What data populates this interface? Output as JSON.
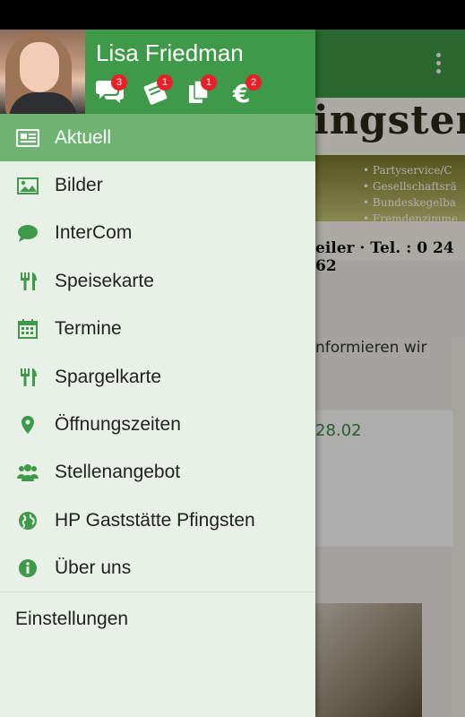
{
  "colors": {
    "primary": "#3e9a48",
    "active_item": "#6fb472",
    "drawer_bg": "#e9f0e7",
    "badge": "#e8202a"
  },
  "background": {
    "logo": "ingsten",
    "services": [
      "Partyservice/C",
      "Gesellschaftsrä",
      "Bundeskegelba",
      "Fremdenzimme"
    ],
    "tel": "eiler · Tel. : 0 24 62",
    "text": "nformieren wir",
    "date": "28.02"
  },
  "header": {
    "user_name": "Lisa Friedman",
    "icons": [
      {
        "icon": "chat-icon",
        "badge": "3"
      },
      {
        "icon": "ticket-icon",
        "badge": "1"
      },
      {
        "icon": "pages-icon",
        "badge": "1"
      },
      {
        "icon": "euro-icon",
        "badge": "2"
      }
    ]
  },
  "menu": {
    "items": [
      {
        "label": "Aktuell",
        "icon": "newspaper-icon"
      },
      {
        "label": "Bilder",
        "icon": "image-icon"
      },
      {
        "label": "InterCom",
        "icon": "speech-bubble-icon"
      },
      {
        "label": "Speisekarte",
        "icon": "cutlery-icon"
      },
      {
        "label": "Termine",
        "icon": "calendar-icon"
      },
      {
        "label": "Spargelkarte",
        "icon": "cutlery-icon"
      },
      {
        "label": "Öffnungszeiten",
        "icon": "location-pin-icon"
      },
      {
        "label": "Stellenangebot",
        "icon": "users-icon"
      },
      {
        "label": "HP Gaststätte Pfingsten",
        "icon": "globe-icon"
      },
      {
        "label": "Über uns",
        "icon": "info-icon"
      }
    ],
    "settings_label": "Einstellungen"
  }
}
